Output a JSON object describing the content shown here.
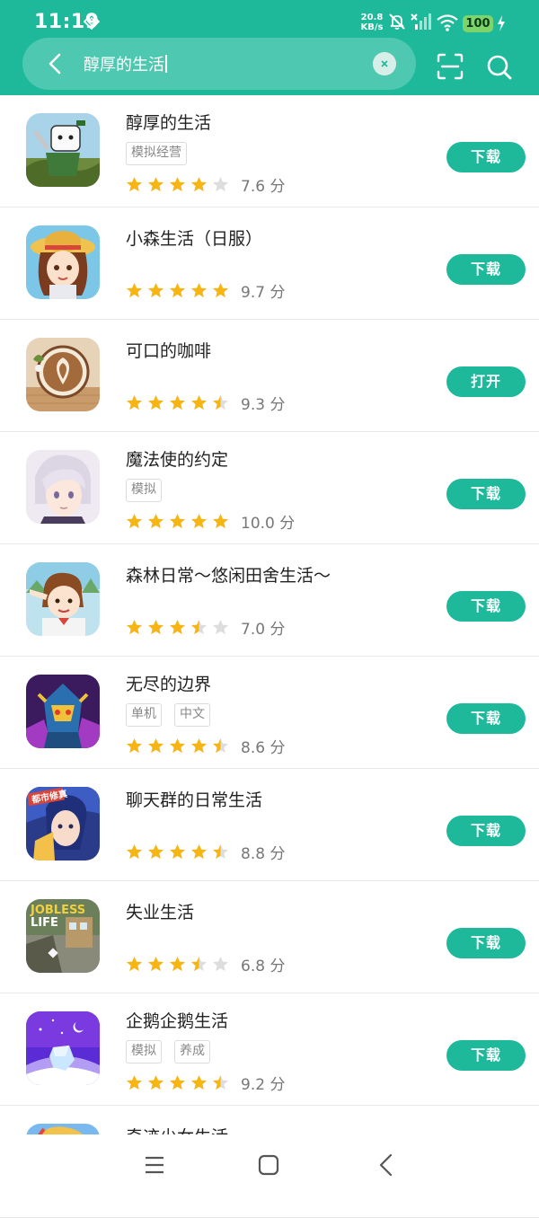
{
  "status_bar": {
    "time": "11:19",
    "net_speed_value": "20.8",
    "net_speed_unit": "KB/s",
    "battery": "100"
  },
  "search": {
    "query": "醇厚的生活"
  },
  "apps": [
    {
      "name": "醇厚的生活",
      "tags": [
        "模拟经营"
      ],
      "rating": 4,
      "score": "7.6",
      "score_unit": "分",
      "action": "下载",
      "icon": "game-icon-white-block-character"
    },
    {
      "name": "小森生活（日服）",
      "tags": [],
      "rating": 5,
      "score": "9.7",
      "score_unit": "分",
      "action": "下载",
      "icon": "game-icon-straw-hat-girl"
    },
    {
      "name": "可口的咖啡",
      "tags": [],
      "rating": 4.5,
      "score": "9.3",
      "score_unit": "分",
      "action": "打开",
      "icon": "game-icon-latte-art"
    },
    {
      "name": "魔法使的约定",
      "tags": [
        "模拟"
      ],
      "rating": 5,
      "score": "10.0",
      "score_unit": "分",
      "action": "下载",
      "icon": "game-icon-silver-hair-boy"
    },
    {
      "name": "森林日常～悠闲田舍生活～",
      "tags": [],
      "rating": 3.5,
      "score": "7.0",
      "score_unit": "分",
      "action": "下载",
      "icon": "game-icon-saluting-girl"
    },
    {
      "name": "无尽的边界",
      "tags": [
        "单机",
        "中文"
      ],
      "rating": 4.5,
      "score": "8.6",
      "score_unit": "分",
      "action": "下载",
      "icon": "game-icon-armored-warrior"
    },
    {
      "name": "聊天群的日常生活",
      "tags": [],
      "rating": 4.5,
      "score": "8.8",
      "score_unit": "分",
      "action": "下载",
      "icon": "game-icon-blue-hair-boy"
    },
    {
      "name": "失业生活",
      "tags": [],
      "rating": 3.5,
      "score": "6.8",
      "score_unit": "分",
      "action": "下载",
      "icon": "game-icon-jobless-life"
    },
    {
      "name": "企鹅企鹅生活",
      "tags": [
        "模拟",
        "养成"
      ],
      "rating": 4.5,
      "score": "9.2",
      "score_unit": "分",
      "action": "下载",
      "icon": "game-icon-purple-night-gem"
    },
    {
      "name": "奇迹少女生活",
      "tags": [],
      "rating": 0,
      "score": "",
      "score_unit": "",
      "action": "",
      "icon": "game-icon-blonde-girl"
    }
  ],
  "icon_art_text": {
    "jobless_line1": "JOBLESS",
    "jobless_line2": "LIFE",
    "blue_hair_banner": "都市修真"
  },
  "colors": {
    "accent": "#1db99a",
    "star": "#f7b514",
    "star_empty": "#dddddd"
  }
}
